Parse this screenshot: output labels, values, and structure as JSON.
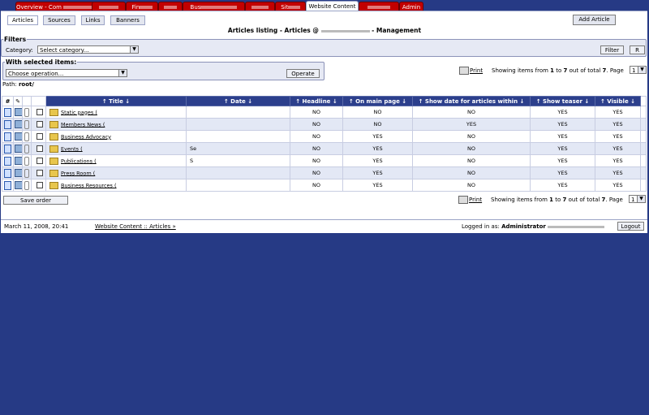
{
  "tabs": [
    {
      "label": "Overview - Com",
      "active": false
    },
    {
      "label": "",
      "active": false
    },
    {
      "label": "Fin",
      "active": false
    },
    {
      "label": "",
      "active": false
    },
    {
      "label": "Bus",
      "active": false
    },
    {
      "label": "",
      "active": false
    },
    {
      "label": "Sit",
      "active": false
    },
    {
      "label": "Website Content",
      "active": true
    },
    {
      "label": "",
      "active": false
    },
    {
      "label": "Admin",
      "active": false
    }
  ],
  "subnav": [
    "Articles",
    "Sources",
    "Links",
    "Banners"
  ],
  "add_article": "Add Article",
  "listing_title_prefix": "Articles listing - Articles @",
  "listing_title_suffix": "- Management",
  "filters": {
    "legend": "Filters",
    "category_label": "Category:",
    "category_value": "Select category...",
    "filter_button": "Filter",
    "reset_button": "R"
  },
  "selected": {
    "legend": "With selected items:",
    "operation_value": "Choose operation...",
    "operate_button": "Operate"
  },
  "print_label": "Print",
  "showing": {
    "prefix": "Showing items from",
    "from": "1",
    "to_word": "to",
    "to": "7",
    "out_of": "out of total",
    "total": "7",
    "page_label": ". Page",
    "page": "1"
  },
  "path_label": "Path:",
  "path_value": "root/",
  "table": {
    "headers": [
      "↑ Title ↓",
      "↑ Date ↓",
      "↑ Headline ↓",
      "↑ On main page ↓",
      "↑ Show date for articles within ↓",
      "↑ Show teaser ↓",
      "↑ Visible ↓"
    ],
    "rows": [
      {
        "title": "Static pages (",
        "date": "",
        "headline": "NO",
        "main": "NO",
        "show_date": "NO",
        "teaser": "YES",
        "visible": "YES"
      },
      {
        "title": "Members News (",
        "date": "",
        "headline": "NO",
        "main": "NO",
        "show_date": "YES",
        "teaser": "YES",
        "visible": "YES"
      },
      {
        "title": "Business Advocacy",
        "date": "",
        "headline": "NO",
        "main": "YES",
        "show_date": "NO",
        "teaser": "YES",
        "visible": "YES"
      },
      {
        "title": "Events (",
        "date": "Se",
        "headline": "NO",
        "main": "YES",
        "show_date": "NO",
        "teaser": "YES",
        "visible": "YES"
      },
      {
        "title": "Publications (",
        "date": "S",
        "headline": "NO",
        "main": "YES",
        "show_date": "NO",
        "teaser": "YES",
        "visible": "YES"
      },
      {
        "title": "Press Room (",
        "date": "",
        "headline": "NO",
        "main": "YES",
        "show_date": "NO",
        "teaser": "YES",
        "visible": "YES"
      },
      {
        "title": "Business Resources (",
        "date": "",
        "headline": "NO",
        "main": "YES",
        "show_date": "NO",
        "teaser": "YES",
        "visible": "YES"
      }
    ]
  },
  "save_order": "Save order",
  "footer": {
    "date": "March 11, 2008, 20:41",
    "crumb": "Website Content :: Articles »",
    "logged_prefix": "Logged in as:",
    "user": "Administrator",
    "logout": "Logout"
  },
  "colors": {
    "background": "#263a85",
    "tab": "#c20000",
    "header": "#2c3f8c"
  }
}
